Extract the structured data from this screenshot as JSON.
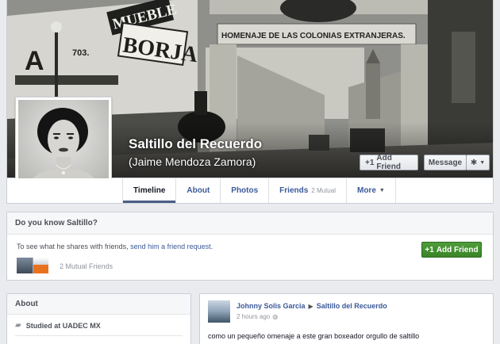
{
  "cover": {
    "page_name": "Saltillo del Recuerdo",
    "alt_name": "(Jaime Mendoza Zamora)",
    "photo_text": {
      "sign_muebles": "MUEBLE",
      "sign_borja": "BORJA",
      "sign_a": "A",
      "sign_number": "703.",
      "arch_banner": "HOMENAJE DE LAS COLONIAS EXTRANJERAS."
    },
    "buttons": {
      "add_friend": "Add Friend",
      "message": "Message"
    },
    "icons": {
      "add_friend": "add-friend-icon",
      "settings": "gear-icon",
      "dropdown": "caret-down-icon"
    }
  },
  "tabs": [
    {
      "label": "Timeline",
      "active": true
    },
    {
      "label": "About"
    },
    {
      "label": "Photos"
    },
    {
      "label": "Friends",
      "count": "2 Mutual"
    },
    {
      "label": "More",
      "has_caret": true
    }
  ],
  "know_box": {
    "title": "Do you know Saltillo?",
    "text_prefix": "To see what he shares with friends, ",
    "link_text": "send him a friend request.",
    "add_friend_label": "Add Friend",
    "mutual_friends": "2 Mutual Friends"
  },
  "about": {
    "title": "About",
    "studied": "Studied at UADEC MX",
    "icon": "graduation-cap-icon"
  },
  "post": {
    "author": "Johnny Solis Garcia",
    "target": "Saltillo del Recuerdo",
    "time": "2 hours ago",
    "privacy_icon": "public-globe-icon",
    "text": "como un pequeño omenaje a este gran boxeador orgullo de saltillo"
  },
  "colors": {
    "link": "#3b5998",
    "green_button": "#4f9d3a",
    "background": "#e9ebee"
  }
}
